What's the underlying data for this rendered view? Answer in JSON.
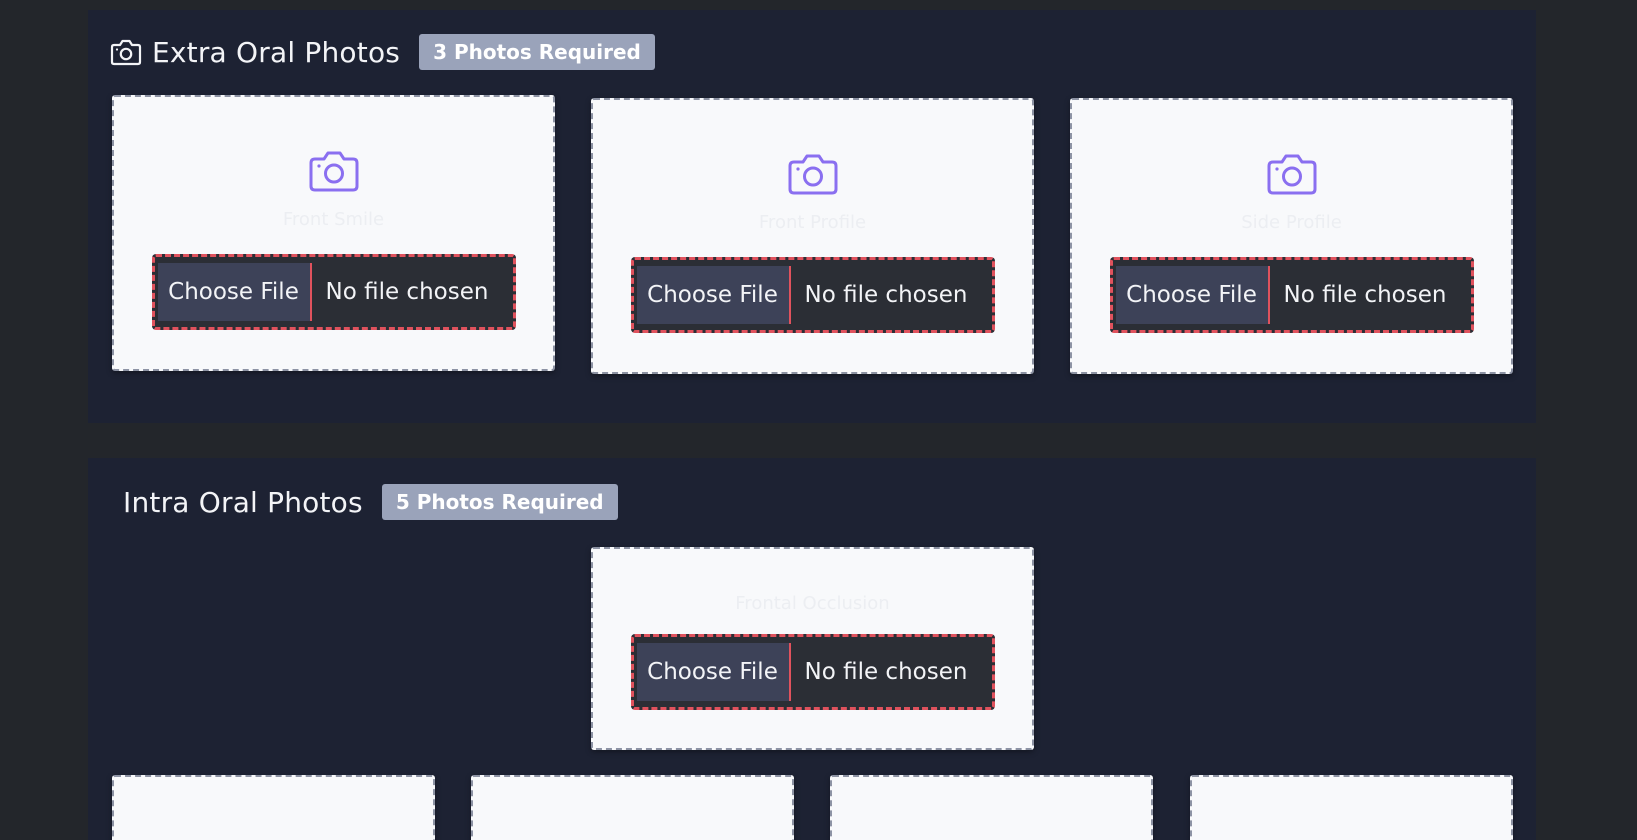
{
  "extra_oral": {
    "title": "Extra Oral Photos",
    "badge": "3 Photos Required",
    "cards": [
      {
        "label": "Front Smile",
        "button": "Choose File",
        "status": "No file chosen"
      },
      {
        "label": "Front Profile",
        "button": "Choose File",
        "status": "No file chosen"
      },
      {
        "label": "Side Profile",
        "button": "Choose File",
        "status": "No file chosen"
      }
    ]
  },
  "intra_oral": {
    "title": "Intra Oral Photos",
    "badge": "5 Photos Required",
    "cards": [
      {
        "label": "Frontal Occlusion",
        "button": "Choose File",
        "status": "No file chosen"
      }
    ],
    "bottom_row_count": 4
  },
  "icons": {
    "header_camera": "camera-outline-icon",
    "card_camera": "camera-outline-icon"
  },
  "colors": {
    "page_bg": "#23262b",
    "section_bg": "#1d2233",
    "badge_bg": "#9aa3ba",
    "accent_camera": "#8a6ff0",
    "error_dashed": "#e0525d"
  }
}
